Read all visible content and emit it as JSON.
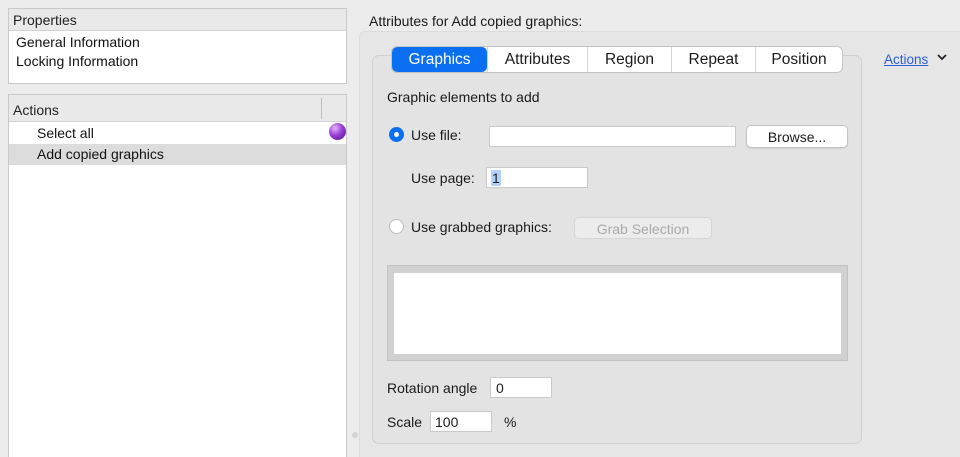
{
  "properties": {
    "header": "Properties",
    "items": [
      "General Information",
      "Locking Information"
    ]
  },
  "actions_panel": {
    "header": "Actions",
    "items": [
      {
        "label": "Select all",
        "selected": false
      },
      {
        "label": "Add copied graphics",
        "selected": true
      }
    ]
  },
  "attributes": {
    "title": "Attributes for Add copied graphics:",
    "actions_link": "Actions",
    "tabs": [
      "Graphics",
      "Attributes",
      "Region",
      "Repeat",
      "Position"
    ],
    "active_tab": "Graphics",
    "section_label": "Graphic elements to add",
    "use_file": {
      "label": "Use file:",
      "value": "",
      "selected": true
    },
    "browse_label": "Browse...",
    "use_page": {
      "label": "Use page:",
      "value": "1"
    },
    "use_grabbed": {
      "label": "Use grabbed graphics:",
      "selected": false
    },
    "grab_selection_label": "Grab Selection",
    "rotation": {
      "label": "Rotation angle",
      "value": "0"
    },
    "scale": {
      "label": "Scale",
      "value": "100",
      "unit": "%"
    }
  },
  "colors": {
    "accent": "#0a6ff0",
    "link": "#2b5fd9",
    "selected_row": "#dcdcdc"
  },
  "icons": {
    "orb": "purple-orb-icon",
    "chevron": "chevron-down-icon"
  }
}
